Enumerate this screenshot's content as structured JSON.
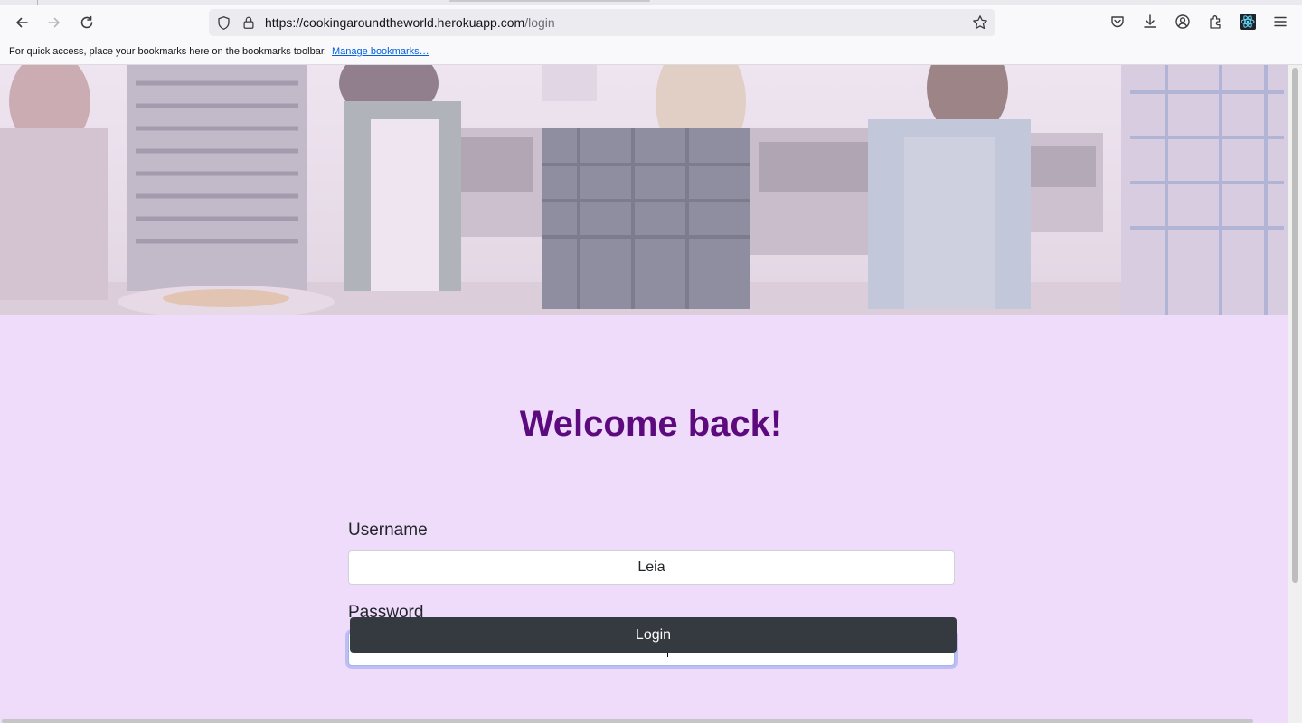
{
  "browser": {
    "url_host": "https://cookingaroundtheworld.herokuapp.com",
    "url_path": "/login",
    "bookmarks_message": "For quick access, place your bookmarks here on the bookmarks toolbar.",
    "bookmarks_link": "Manage bookmarks…",
    "icons": {
      "back": "arrow-left-icon",
      "forward": "arrow-right-icon",
      "reload": "reload-icon",
      "shield": "shield-icon",
      "lock": "lock-icon",
      "star": "star-icon",
      "pocket": "pocket-icon",
      "downloads": "download-icon",
      "account": "account-icon",
      "extensions": "extensions-icon",
      "react_devtools": "react-icon",
      "menu": "hamburger-menu-icon"
    }
  },
  "login": {
    "heading": "Welcome back!",
    "username_label": "Username",
    "username_value": "Leia",
    "password_label": "Password",
    "password_value": "••••••••••",
    "submit_label": "Login"
  },
  "colors": {
    "page_background": "#efdcfb",
    "heading": "#5c0a7e",
    "button": "#343a40"
  }
}
